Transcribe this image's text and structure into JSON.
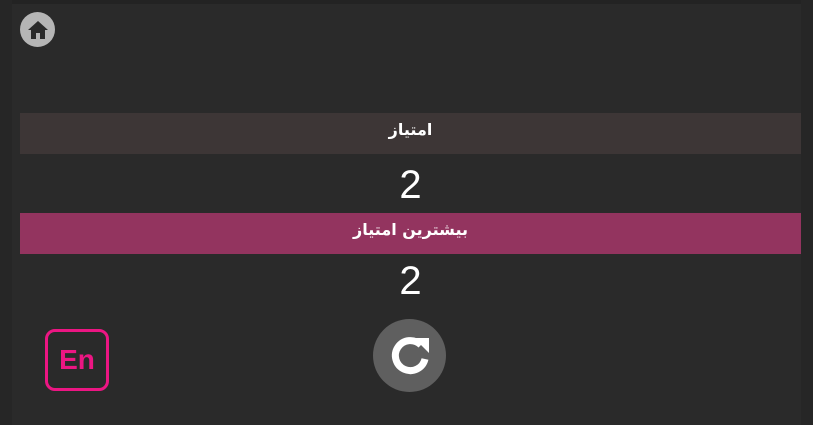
{
  "header": {
    "home_icon": "home-icon"
  },
  "score": {
    "label": "امتیاز",
    "value": "2"
  },
  "best_score": {
    "label": "بیشترین امتیاز",
    "value": "2"
  },
  "controls": {
    "language_label": "En",
    "restart_icon": "restart-icon"
  },
  "colors": {
    "background": "#2a2a2a",
    "score_bar": "#3d3636",
    "best_bar": "#93345f",
    "accent_pink": "#ec1683"
  }
}
